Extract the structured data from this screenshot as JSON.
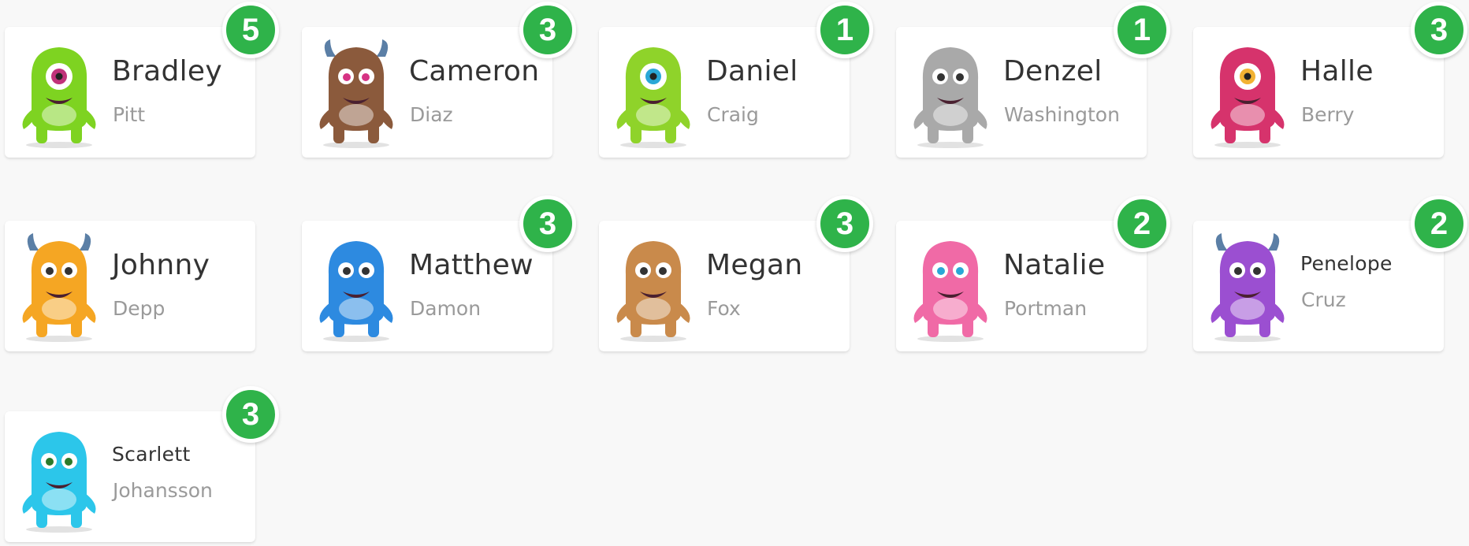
{
  "students": [
    {
      "first": "Bradley",
      "last": "Pitt",
      "points": "5",
      "color": "#7ed321",
      "eye": "#c0327a",
      "avatar_icon": "green-one-eyed-monster-icon"
    },
    {
      "first": "Cameron",
      "last": "Diaz",
      "points": "3",
      "color": "#8b5a3c",
      "eye": "#d63384",
      "avatar_icon": "brown-antler-monster-icon"
    },
    {
      "first": "Daniel",
      "last": "Craig",
      "points": "1",
      "color": "#8fd32a",
      "eye": "#2aa7d6",
      "avatar_icon": "green-antenna-monster-icon"
    },
    {
      "first": "Denzel",
      "last": "Washington",
      "points": "1",
      "color": "#a9a9a9",
      "eye": "#333333",
      "avatar_icon": "gray-monster-icon"
    },
    {
      "first": "Halle",
      "last": "Berry",
      "points": "3",
      "color": "#d6336c",
      "eye": "#f2b233",
      "avatar_icon": "pink-one-eyed-monster-icon"
    },
    {
      "first": "Johnny",
      "last": "Depp",
      "points": "",
      "color": "#f5a623",
      "eye": "#333333",
      "avatar_icon": "orange-horned-monster-icon"
    },
    {
      "first": "Matthew",
      "last": "Damon",
      "points": "3",
      "color": "#2d8ae0",
      "eye": "#333333",
      "avatar_icon": "blue-monster-icon"
    },
    {
      "first": "Megan",
      "last": "Fox",
      "points": "3",
      "color": "#c98a4b",
      "eye": "#333333",
      "avatar_icon": "calico-monster-icon"
    },
    {
      "first": "Natalie",
      "last": "Portman",
      "points": "2",
      "color": "#f06aa6",
      "eye": "#2aa7d6",
      "avatar_icon": "pink-monster-icon"
    },
    {
      "first": "Penelope",
      "last": "Cruz",
      "points": "2",
      "color": "#9b4fd1",
      "eye": "#333333",
      "avatar_icon": "purple-horned-monster-icon"
    },
    {
      "first": "Scarlett",
      "last": "Johansson",
      "points": "3",
      "color": "#2cc6ea",
      "eye": "#2a7a2a",
      "avatar_icon": "cyan-monster-icon"
    }
  ],
  "colors": {
    "badge": "#2fb34a",
    "card": "#ffffff",
    "background": "#f8f8f8"
  }
}
